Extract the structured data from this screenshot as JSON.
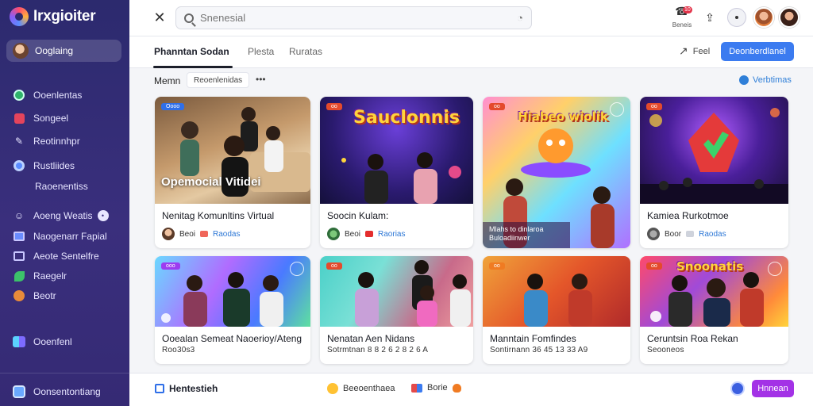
{
  "app": {
    "name": "Irxgioiter"
  },
  "sidebar": {
    "active_item": "Ooglaing",
    "items": [
      {
        "label": "Ooenlentas",
        "icon": "globe-icon"
      },
      {
        "label": "Songeel",
        "icon": "video-icon"
      },
      {
        "label": "Reotinnhpr",
        "icon": "tools-icon"
      },
      {
        "label": "Rustliides",
        "icon": "circle-icon"
      },
      {
        "label": "Raoenentiss",
        "icon": ""
      },
      {
        "label": "Aoeng Weatis",
        "icon": "people-icon",
        "badge": ""
      },
      {
        "label": "Naogenarr Fapial",
        "icon": "group-icon"
      },
      {
        "label": "Aeote Sentelfre",
        "icon": "screen-icon"
      },
      {
        "label": "Raegelr",
        "icon": "leaf-icon"
      },
      {
        "label": "Beotr",
        "icon": "cookie-icon"
      },
      {
        "label": "Ooenfenl",
        "icon": "layout-icon"
      }
    ],
    "footer_label": "Oonsentontiang"
  },
  "topbar": {
    "search_placeholder": "Snenesial",
    "notification_count": "10",
    "notification_label": "Beneis"
  },
  "tabs": [
    {
      "label": "Phanntan Sodan",
      "active": true
    },
    {
      "label": "Plesta",
      "active": false
    },
    {
      "label": "Ruratas",
      "active": false
    }
  ],
  "actions": {
    "share_label": "Feel",
    "primary_label": "Deonberdlanel"
  },
  "filter": {
    "label": "Memn",
    "chip": "Reoenlenidas",
    "more": "•••",
    "view_toggle": "Verbtimas"
  },
  "cards": [
    {
      "title": "Nenitag Komunltins Virtual",
      "tag": "Oooo",
      "overlay": "Opemocial Vitidei",
      "meta_user": "Beoi",
      "meta_link": "Raodas"
    },
    {
      "title": "Soocin Kulam:",
      "tag": "oo",
      "overlay": "Sauclonnis",
      "meta_user": "Beoi",
      "meta_link": "Raorias"
    },
    {
      "title": "",
      "tag": "oo",
      "overlay": "Mlahs to dinlaroa Buloadiinwer",
      "banner": "Hiabeo wiolik"
    },
    {
      "title": "Kamiea Rurkotmoe",
      "tag": "oo",
      "meta_user": "Boor",
      "meta_link": "Raodas"
    },
    {
      "title": "Ooealan Semeat Naoerioy/Ateng",
      "tag": "ooo",
      "sub": "Roo30s3"
    },
    {
      "title": "Nenatan Aen Nidans",
      "tag": "oo",
      "sub": "Sotrmtnan 8 8 2 6 2 8 2 6 A"
    },
    {
      "title": "Manntain Fomfindes",
      "tag": "oo",
      "sub": "Sontirnann 36 45 13 33 A9"
    },
    {
      "title": "Ceruntsin Roa Rekan",
      "tag": "oo",
      "sub": "Seooneos",
      "banner": "Snoonatis"
    }
  ],
  "bottombar": {
    "title": "Hentestieh",
    "item1": "Beeoenthaea",
    "item2": "Borie",
    "button": "Hnnean"
  },
  "colors": {
    "sidebar": "#2c2a6e",
    "primary": "#3b7bf0",
    "accent": "#a332e6"
  }
}
